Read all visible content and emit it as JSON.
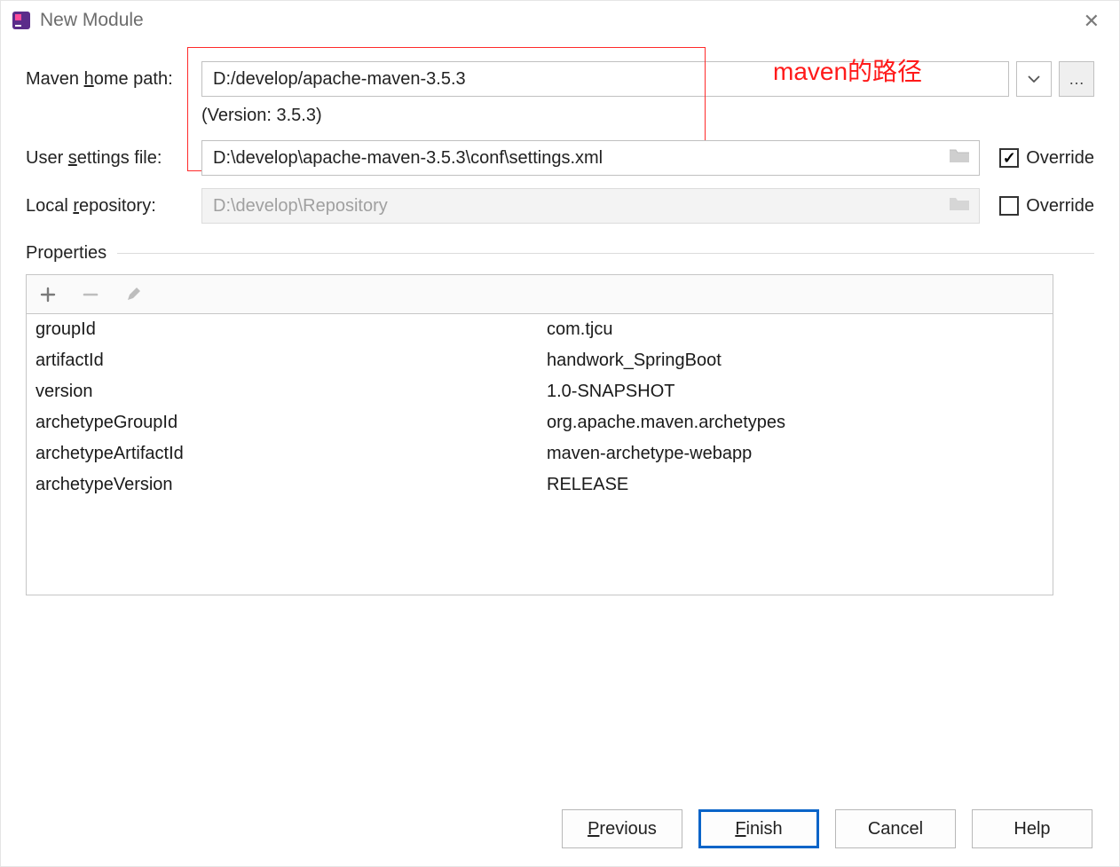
{
  "window": {
    "title": "New Module"
  },
  "annotation": "maven的路径",
  "labels": {
    "maven_home_pre": "Maven ",
    "maven_home_mn": "h",
    "maven_home_post": "ome path:",
    "user_settings_pre": "User ",
    "user_settings_mn": "s",
    "user_settings_post": "ettings file:",
    "local_repo_pre": "Local ",
    "local_repo_mn": "r",
    "local_repo_post": "epository:",
    "properties": "Properties",
    "override1": "Override",
    "override2": "Override"
  },
  "fields": {
    "maven_home": "D:/develop/apache-maven-3.5.3",
    "maven_version": "(Version: 3.5.3)",
    "user_settings": "D:\\develop\\apache-maven-3.5.3\\conf\\settings.xml",
    "local_repo": "D:\\develop\\Repository"
  },
  "overrides": {
    "user_settings": true,
    "local_repo": false
  },
  "properties": [
    {
      "key": "groupId",
      "value": "com.tjcu"
    },
    {
      "key": "artifactId",
      "value": "handwork_SpringBoot"
    },
    {
      "key": "version",
      "value": "1.0-SNAPSHOT"
    },
    {
      "key": "archetypeGroupId",
      "value": "org.apache.maven.archetypes"
    },
    {
      "key": "archetypeArtifactId",
      "value": "maven-archetype-webapp"
    },
    {
      "key": "archetypeVersion",
      "value": "RELEASE"
    }
  ],
  "buttons": {
    "previous_mn": "P",
    "previous_post": "revious",
    "finish_mn": "F",
    "finish_post": "inish",
    "cancel": "Cancel",
    "help": "Help",
    "ellipsis": "…"
  }
}
